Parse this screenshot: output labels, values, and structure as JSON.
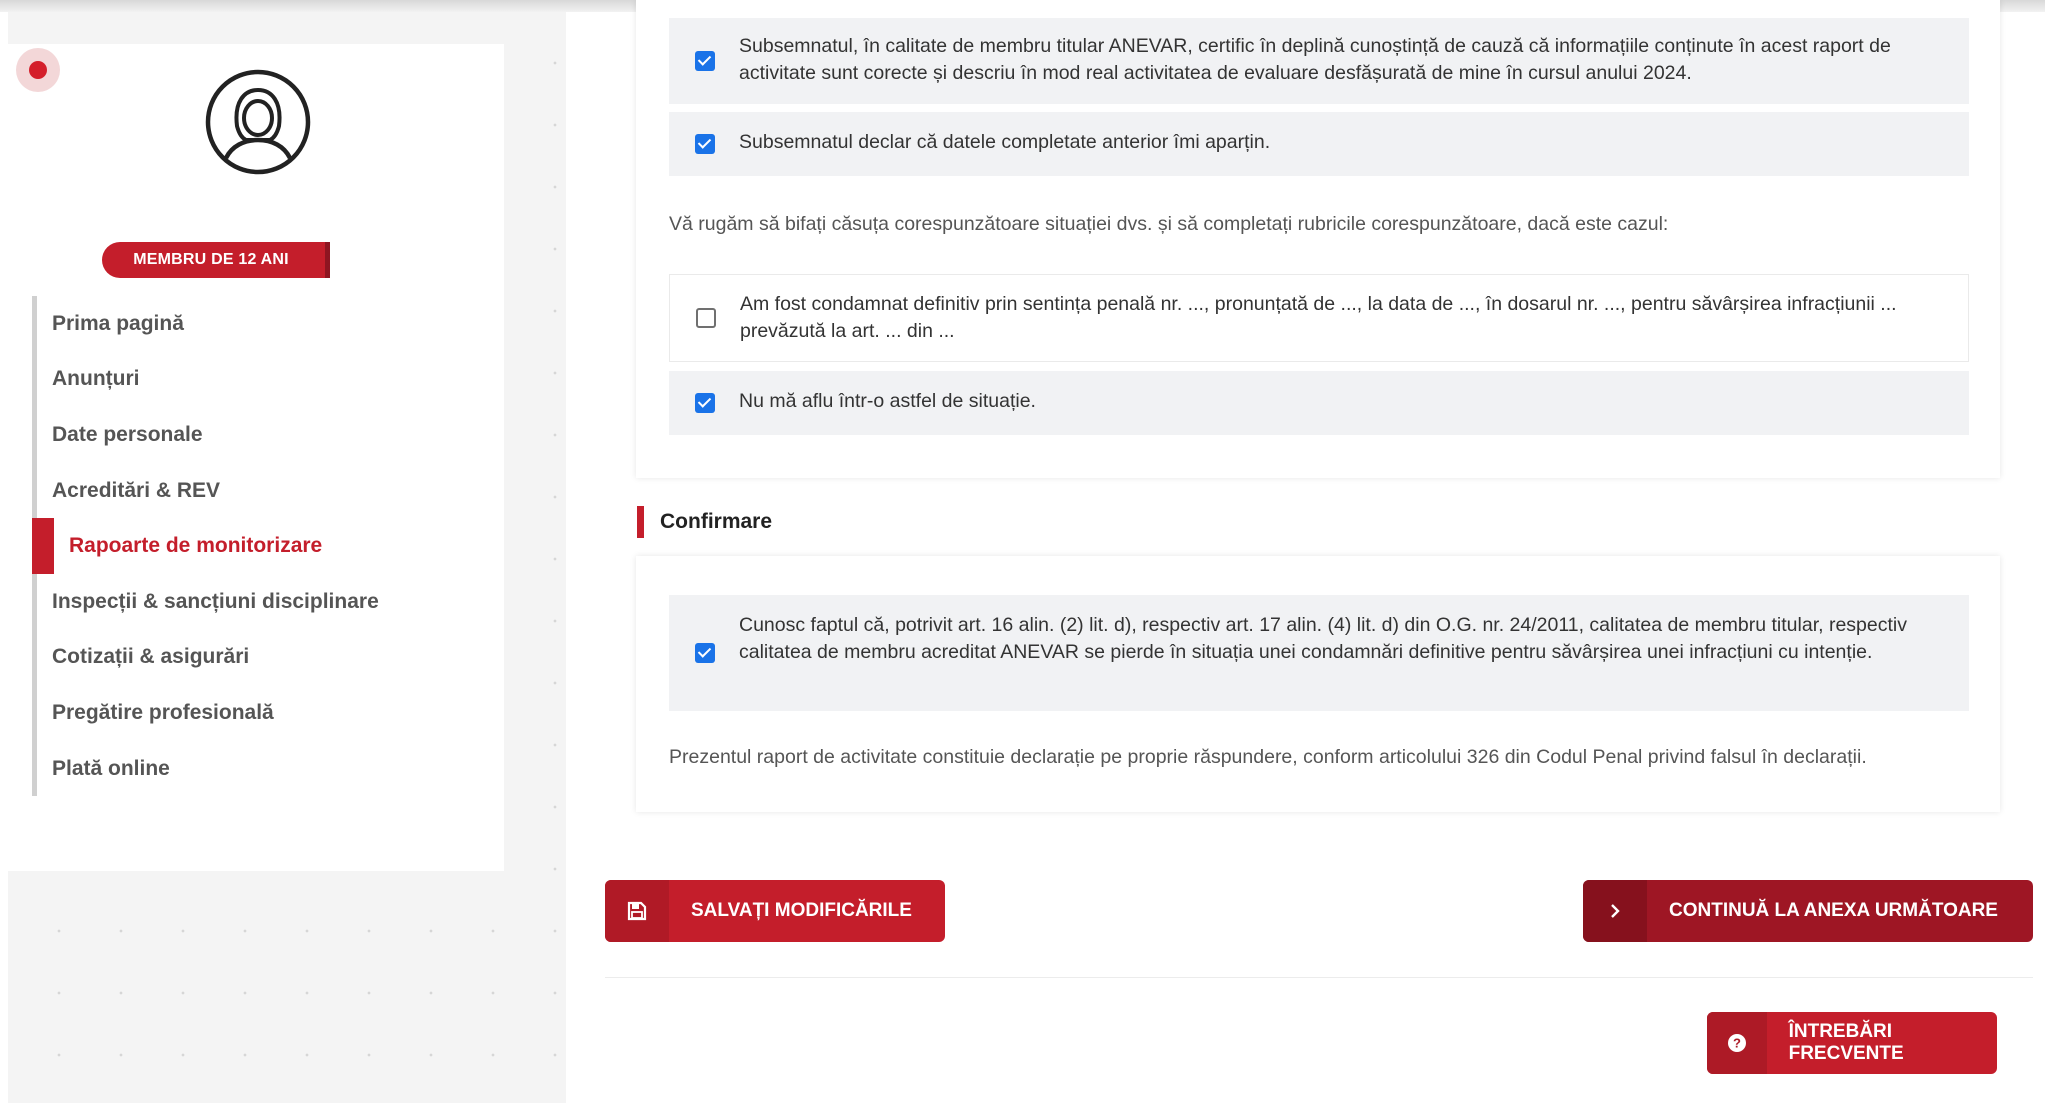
{
  "sidebar": {
    "badge": "MEMBRU DE 12 ANI",
    "items": [
      {
        "label": "Prima pagină"
      },
      {
        "label": "Anunțuri"
      },
      {
        "label": "Date personale"
      },
      {
        "label": "Acreditări & REV"
      },
      {
        "label": "Rapoarte de monitorizare",
        "active": true
      },
      {
        "label": "Inspecții & sancțiuni disciplinare"
      },
      {
        "label": "Cotizații & asigurări"
      },
      {
        "label": "Pregătire profesională"
      },
      {
        "label": "Plată online"
      }
    ]
  },
  "declarations": {
    "certify": {
      "checked": true,
      "text": "Subsemnatul, în calitate de membru titular ANEVAR, certific în deplină cunoștință de cauză că informațiile conținute în acest raport de activitate sunt corecte și descriu în mod real activitatea de evaluare desfășurată de mine în cursul anului 2024."
    },
    "data_owner": {
      "checked": true,
      "text": "Subsemnatul declar că datele completate anterior îmi aparțin."
    },
    "instruction": "Vă rugăm să bifați căsuța corespunzătoare situației dvs. și să completați rubricile corespunzătoare, dacă este cazul:",
    "condemned": {
      "checked": false,
      "text": "Am fost condamnat definitiv prin sentința penală nr. ..., pronunțată de ..., la data de ..., în dosarul nr. ..., pentru săvârșirea infracțiunii ... prevăzută la art. ... din ..."
    },
    "not_condemned": {
      "checked": true,
      "text": "Nu mă aflu într-o astfel de situație."
    }
  },
  "confirm": {
    "heading": "Confirmare",
    "ack": {
      "checked": true,
      "text": "Cunosc faptul că, potrivit art. 16 alin. (2) lit. d), respectiv art. 17 alin. (4) lit. d) din O.G. nr. 24/2011, calitatea de membru titular, respectiv calitatea de membru acreditat ANEVAR se pierde în situația unei condamnări definitive pentru săvârșirea unei infracțiuni cu intenție."
    },
    "footer": "Prezentul raport de activitate constituie declarație pe proprie răspundere, conform articolului 326 din Codul Penal privind falsul în declarații."
  },
  "actions": {
    "save_label": "SALVAȚI MODIFICĂRILE",
    "next_label": "CONTINUĂ LA ANEXA URMĂTOARE",
    "faq_label": "ÎNTREBĂRI FRECVENTE"
  },
  "colors": {
    "accent": "#c41e2b",
    "dark_accent": "#9e1624",
    "checkbox": "#1a73e8"
  },
  "icons": {
    "save": "floppy-disk-icon",
    "next": "chevron-right-icon",
    "faq": "question-circle-icon",
    "avatar": "user-avatar-icon"
  }
}
